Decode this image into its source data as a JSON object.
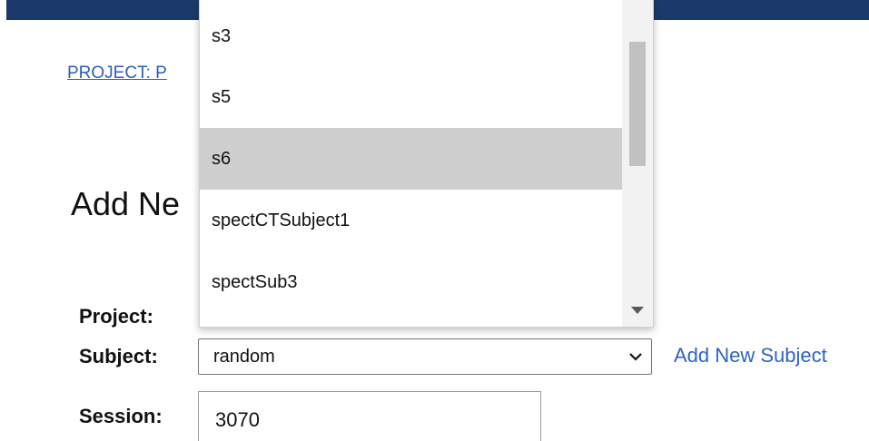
{
  "breadcrumb": {
    "text": "PROJECT: P"
  },
  "page": {
    "title": "Add Ne"
  },
  "form": {
    "project_label": "Project:",
    "subject_label": "Subject:",
    "subject_value": "random",
    "add_subject_link": "Add New Subject",
    "session_label": "Session:",
    "session_value": "3070"
  },
  "dropdown": {
    "items": [
      {
        "label": "s3"
      },
      {
        "label": "s5"
      },
      {
        "label": "s6",
        "selected": true
      },
      {
        "label": "spectCTSubject1"
      },
      {
        "label": "spectSub3"
      }
    ]
  },
  "colors": {
    "header": "#1b3a6b",
    "link": "#2b64c6",
    "highlight": "#cfcfcf"
  }
}
